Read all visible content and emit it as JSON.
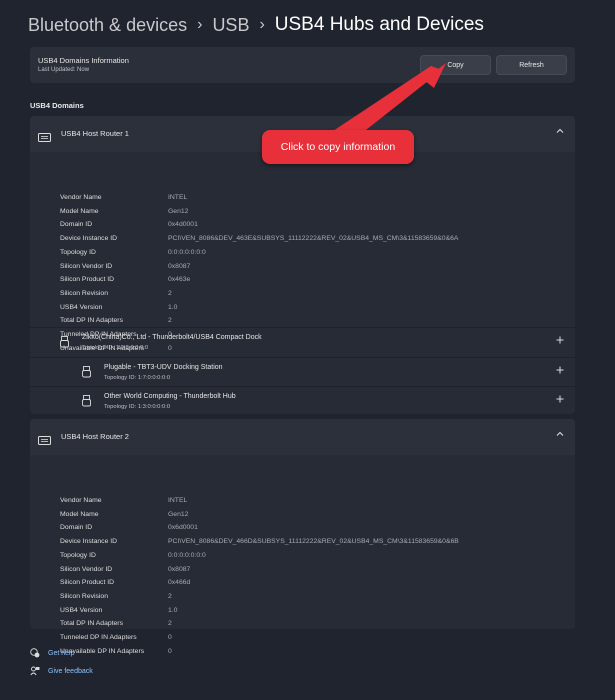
{
  "breadcrumb": {
    "item1": "Bluetooth & devices",
    "item2": "USB",
    "current": "USB4 Hubs and Devices",
    "separator": "›"
  },
  "info": {
    "title": "USB4 Domains Information",
    "last_updated": "Last Updated:  Now",
    "copy_label": "Copy",
    "refresh_label": "Refresh"
  },
  "section_label": "USB4 Domains",
  "callout": "Click to copy information",
  "routers": [
    {
      "name": "USB4 Host Router 1",
      "props": [
        {
          "k": "Vendor Name",
          "v": "INTEL"
        },
        {
          "k": "Model Name",
          "v": "Gen12"
        },
        {
          "k": "Domain ID",
          "v": "0x4d0001"
        },
        {
          "k": "Device Instance ID",
          "v": "PCI\\VEN_8086&DEV_463E&SUBSYS_11112222&REV_02&USB4_MS_CM\\3&11583659&0&6A"
        },
        {
          "k": "Topology ID",
          "v": "0:0:0:0:0:0:0"
        },
        {
          "k": "Silicon Vendor ID",
          "v": "0x8087"
        },
        {
          "k": "Silicon Product ID",
          "v": "0x463e"
        },
        {
          "k": "Silicon Revision",
          "v": "2"
        },
        {
          "k": "USB4 Version",
          "v": "1.0"
        },
        {
          "k": "Total DP IN Adapters",
          "v": "2"
        },
        {
          "k": "Tunneled DP IN Adapters",
          "v": "0"
        },
        {
          "k": "Unavailable DP IN Adapters",
          "v": "0"
        }
      ],
      "children": [
        {
          "name": "Zikko(China)Co., Ltd - Thunderbolt4/USB4 Compact Dock",
          "topology": "Topology ID:  1:0:0:0:0:0:0"
        },
        {
          "name": "Plugable - TBT3-UDV Docking Station",
          "topology": "Topology ID:  1:7:0:0:0:0:0"
        },
        {
          "name": "Other World Computing - Thunderbolt Hub",
          "topology": "Topology ID:  1:3:0:0:0:0:0"
        }
      ]
    },
    {
      "name": "USB4 Host Router 2",
      "props": [
        {
          "k": "Vendor Name",
          "v": "INTEL"
        },
        {
          "k": "Model Name",
          "v": "Gen12"
        },
        {
          "k": "Domain ID",
          "v": "0x6d0001"
        },
        {
          "k": "Device Instance ID",
          "v": "PCI\\VEN_8086&DEV_466D&SUBSYS_11112222&REV_02&USB4_MS_CM\\3&11583659&0&6B"
        },
        {
          "k": "Topology ID",
          "v": "0:0:0:0:0:0:0"
        },
        {
          "k": "Silicon Vendor ID",
          "v": "0x8087"
        },
        {
          "k": "Silicon Product ID",
          "v": "0x466d"
        },
        {
          "k": "Silicon Revision",
          "v": "2"
        },
        {
          "k": "USB4 Version",
          "v": "1.0"
        },
        {
          "k": "Total DP IN Adapters",
          "v": "2"
        },
        {
          "k": "Tunneled DP IN Adapters",
          "v": "0"
        },
        {
          "k": "Unavailable DP IN Adapters",
          "v": "0"
        }
      ]
    }
  ],
  "footer": {
    "help": "Get help",
    "feedback": "Give feedback"
  },
  "icons": {
    "router": "host-router-icon",
    "usb": "usb-device-icon",
    "expand": "chevron-up-icon",
    "add": "plus-icon",
    "help": "help-icon",
    "feedback": "feedback-icon"
  },
  "colors": {
    "background": "#20242e",
    "card": "#2b2f39",
    "link": "#8fc3ff",
    "callout": "#e8303a"
  }
}
